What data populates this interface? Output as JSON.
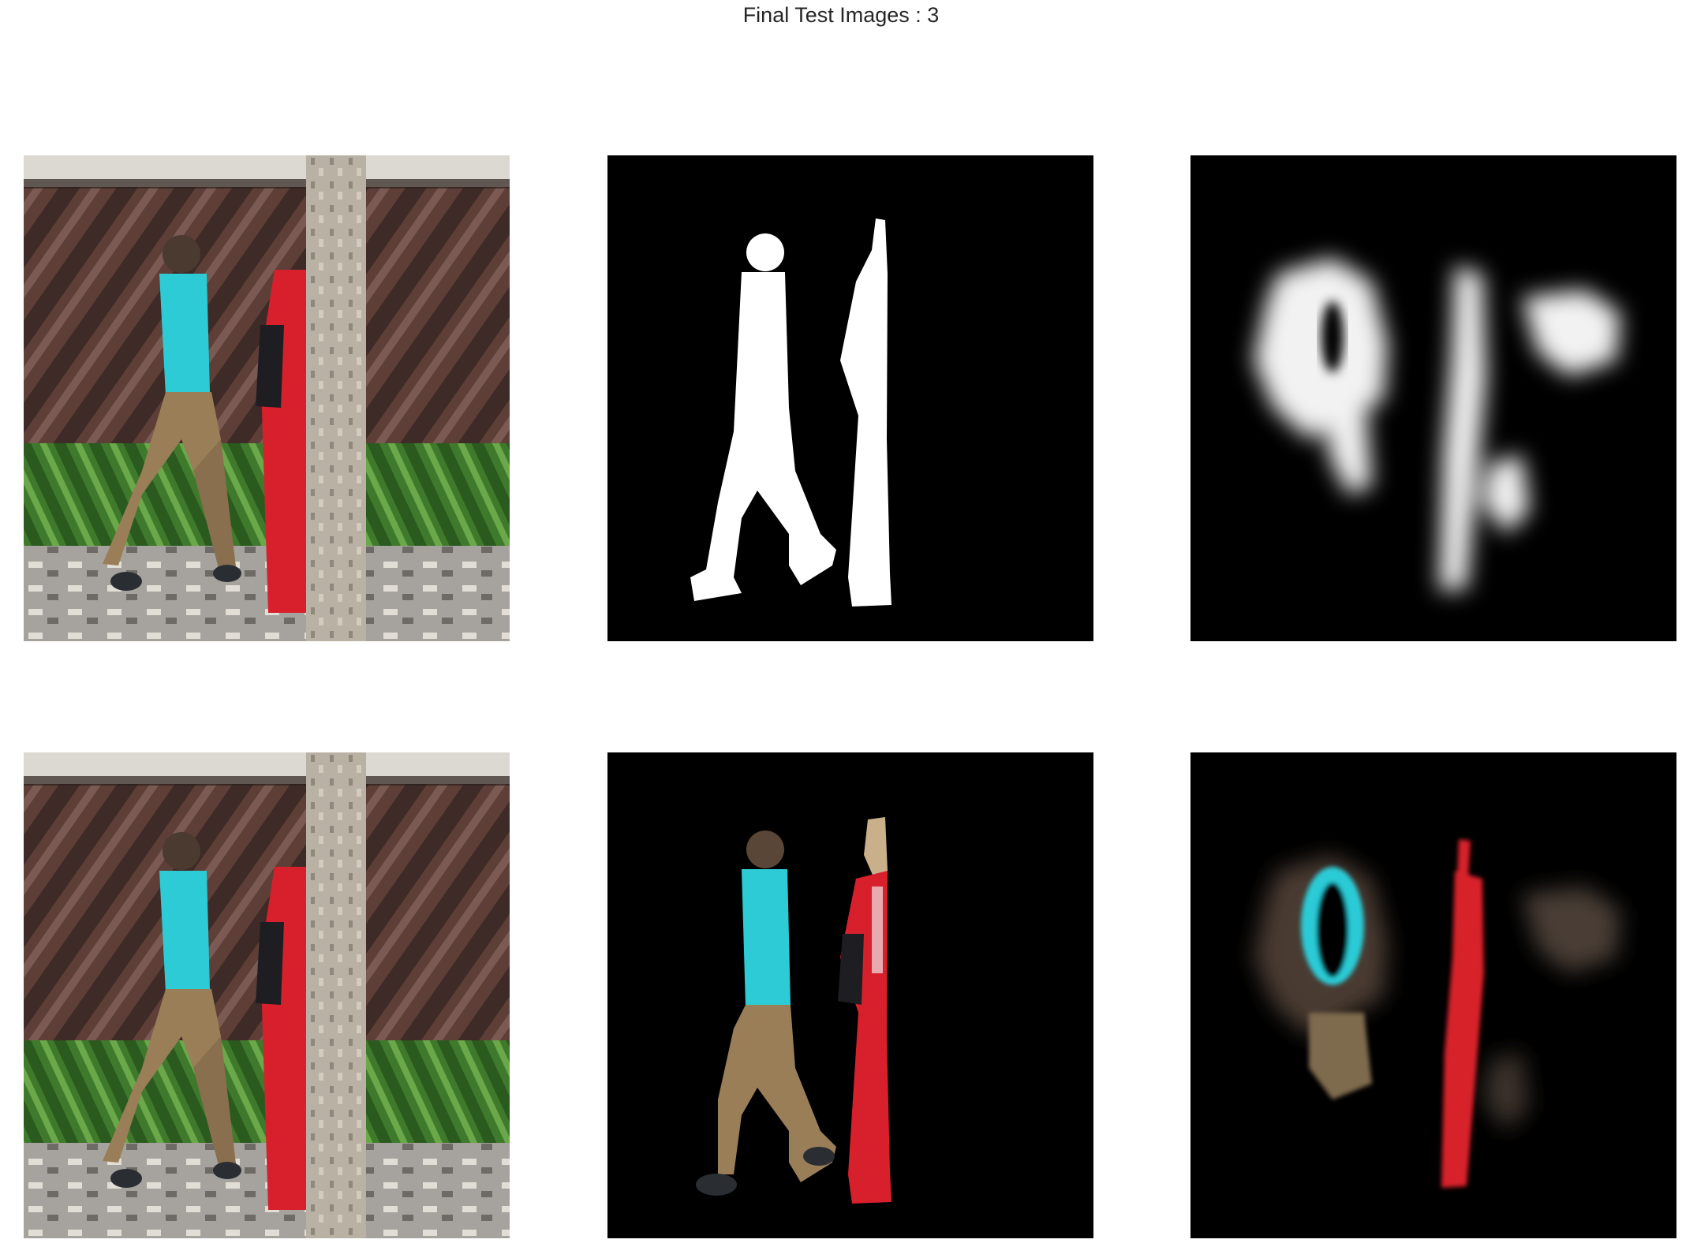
{
  "figure": {
    "title": "Final Test Images : 3"
  },
  "panels": [
    {
      "row": 1,
      "col": 1,
      "content": "original-photo"
    },
    {
      "row": 1,
      "col": 2,
      "content": "ground-truth-mask"
    },
    {
      "row": 1,
      "col": 3,
      "content": "predicted-mask"
    },
    {
      "row": 2,
      "col": 1,
      "content": "original-photo"
    },
    {
      "row": 2,
      "col": 2,
      "content": "ground-truth-segmentation"
    },
    {
      "row": 2,
      "col": 3,
      "content": "predicted-segmentation"
    }
  ],
  "colors": {
    "background": "#ffffff",
    "title_text": "#262626",
    "mask_background": "#000000",
    "mask_foreground": "#ffffff",
    "shirt_cyan": "#2ccbd6",
    "clothing_red": "#d8202c",
    "shorts_khaki": "#9a7e58",
    "wall_brown": "#5e3f37",
    "foliage_green": "#3f7a2c",
    "tree_bark": "#b9b1a3"
  }
}
